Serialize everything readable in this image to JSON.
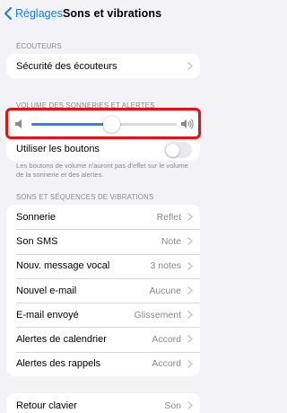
{
  "nav": {
    "back_label": "Réglages",
    "title": "Sons et vibrations"
  },
  "sections": {
    "headphones_header": "ÉCOUTEURS",
    "headphones_row": "Sécurité des écouteurs",
    "volume_header": "VOLUME DES SONNERIES ET ALERTES",
    "volume_level": 0.55,
    "buttons_label": "Utiliser les boutons",
    "buttons_toggle_on": false,
    "buttons_note": "Les boutons de volume n'auront pas d'effet sur le volume de la sonnerie et des alertes.",
    "sounds_header": "SONS ET SÉQUENCES DE VIBRATIONS"
  },
  "sounds": [
    {
      "label": "Sonnerie",
      "value": "Reflet"
    },
    {
      "label": "Son SMS",
      "value": "Note"
    },
    {
      "label": "Nouv. message vocal",
      "value": "3 notes"
    },
    {
      "label": "Nouvel e-mail",
      "value": "Aucune"
    },
    {
      "label": "E-mail envoyé",
      "value": "Glissement"
    },
    {
      "label": "Alertes de calendrier",
      "value": "Accord"
    },
    {
      "label": "Alertes des rappels",
      "value": "Accord"
    }
  ],
  "keyboard": {
    "label": "Retour clavier",
    "value": "Son"
  },
  "colors": {
    "accent": "#2f7ff5",
    "link": "#1a7cf0",
    "highlight": "#e01414"
  },
  "icons": [
    "chevron-left-icon",
    "chevron-right-icon",
    "volume-low-icon",
    "volume-high-icon"
  ]
}
